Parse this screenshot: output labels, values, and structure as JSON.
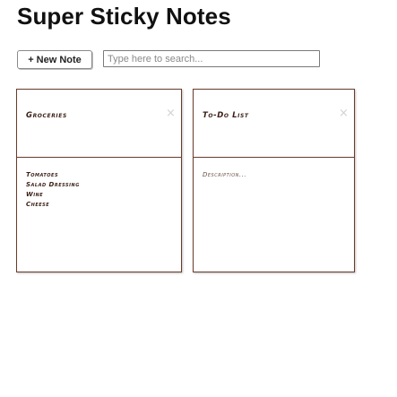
{
  "app": {
    "title": "Super Sticky Notes"
  },
  "toolbar": {
    "new_note_label": "+ New Note",
    "search_placeholder": "Type here to search..."
  },
  "notes": [
    {
      "title": "Groceries",
      "close": "×",
      "lines": [
        "Tomatoes",
        "Salad Dressing",
        "Wine",
        "Cheese"
      ]
    },
    {
      "title": "To-Do List",
      "close": "×",
      "lines": [
        "Description..."
      ]
    }
  ],
  "icons": {
    "close": "close-icon"
  }
}
